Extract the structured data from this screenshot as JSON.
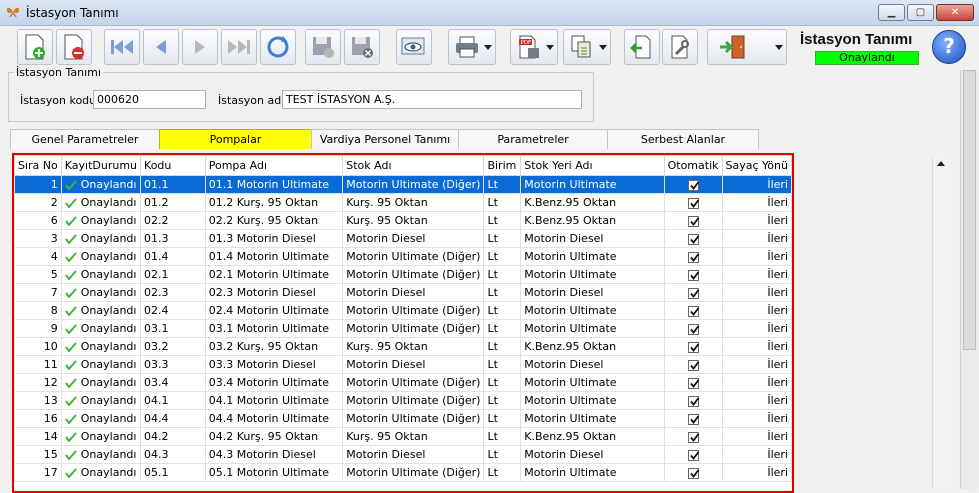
{
  "window": {
    "title": "İstasyon Tanımı"
  },
  "header": {
    "title": "İstasyon Tanımı",
    "status": "Onaylandı"
  },
  "group": {
    "legend": "İstasyon Tanımı",
    "code_label": "İstasyon kodu",
    "code_value": "000620",
    "name_label": "İstasyon adı",
    "name_value": "TEST İSTASYON A.Ş."
  },
  "tabs": [
    {
      "label": "Genel Parametreler"
    },
    {
      "label": "Pompalar",
      "active": true
    },
    {
      "label": "Vardiya Personel Tanımı"
    },
    {
      "label": "Parametreler"
    },
    {
      "label": "Serbest Alanlar"
    }
  ],
  "toolbar": {
    "icons": [
      "new-icon",
      "delete-icon",
      "first-icon",
      "previous-icon",
      "next-icon",
      "last-icon",
      "refresh-icon",
      "save-icon",
      "cancel-icon",
      "preview-icon",
      "print-icon",
      "pdf-export-icon",
      "copy-icon",
      "import-icon",
      "tools-icon",
      "exit-icon",
      "help-icon"
    ],
    "pdf_label": "PDF",
    "help_label": "?"
  },
  "grid": {
    "columns": [
      "Sıra No",
      "KayıtDurumu",
      "Kodu",
      "Pompa Adı",
      "Stok Adı",
      "Birim",
      "Stok Yeri Adı",
      "Otomatik",
      "Sayaç Yönü"
    ],
    "rows": [
      {
        "sira": "1",
        "durum": "Onaylandı",
        "kodu": "01.1",
        "pompa": "01.1 Motorin Ultimate",
        "stok": "Motorin Ultimate (Diğer)",
        "birim": "Lt",
        "yer": "Motorin Ultimate",
        "yon": "İleri"
      },
      {
        "sira": "2",
        "durum": "Onaylandı",
        "kodu": "01.2",
        "pompa": "01.2 Kurş. 95 Oktan",
        "stok": "Kurş. 95 Oktan",
        "birim": "Lt",
        "yer": "K.Benz.95 Oktan",
        "yon": "İleri"
      },
      {
        "sira": "6",
        "durum": "Onaylandı",
        "kodu": "02.2",
        "pompa": "02.2 Kurş. 95 Oktan",
        "stok": "Kurş. 95 Oktan",
        "birim": "Lt",
        "yer": "K.Benz.95 Oktan",
        "yon": "İleri"
      },
      {
        "sira": "3",
        "durum": "Onaylandı",
        "kodu": "01.3",
        "pompa": "01.3 Motorin Diesel",
        "stok": "Motorin Diesel",
        "birim": "Lt",
        "yer": "Motorin Diesel",
        "yon": "İleri"
      },
      {
        "sira": "4",
        "durum": "Onaylandı",
        "kodu": "01.4",
        "pompa": "01.4 Motorin Ultimate",
        "stok": "Motorin Ultimate (Diğer)",
        "birim": "Lt",
        "yer": "Motorin Ultimate",
        "yon": "İleri"
      },
      {
        "sira": "5",
        "durum": "Onaylandı",
        "kodu": "02.1",
        "pompa": "02.1 Motorin Ultimate",
        "stok": "Motorin Ultimate (Diğer)",
        "birim": "Lt",
        "yer": "Motorin Ultimate",
        "yon": "İleri"
      },
      {
        "sira": "7",
        "durum": "Onaylandı",
        "kodu": "02.3",
        "pompa": "02.3 Motorin Diesel",
        "stok": "Motorin Diesel",
        "birim": "Lt",
        "yer": "Motorin Diesel",
        "yon": "İleri"
      },
      {
        "sira": "8",
        "durum": "Onaylandı",
        "kodu": "02.4",
        "pompa": "02.4 Motorin Ultimate",
        "stok": "Motorin Ultimate (Diğer)",
        "birim": "Lt",
        "yer": "Motorin Ultimate",
        "yon": "İleri"
      },
      {
        "sira": "9",
        "durum": "Onaylandı",
        "kodu": "03.1",
        "pompa": "03.1 Motorin Ultimate",
        "stok": "Motorin Ultimate (Diğer)",
        "birim": "Lt",
        "yer": "Motorin Ultimate",
        "yon": "İleri"
      },
      {
        "sira": "10",
        "durum": "Onaylandı",
        "kodu": "03.2",
        "pompa": "03.2 Kurş. 95 Oktan",
        "stok": "Kurş. 95 Oktan",
        "birim": "Lt",
        "yer": "K.Benz.95 Oktan",
        "yon": "İleri"
      },
      {
        "sira": "11",
        "durum": "Onaylandı",
        "kodu": "03.3",
        "pompa": "03.3 Motorin Diesel",
        "stok": "Motorin Diesel",
        "birim": "Lt",
        "yer": "Motorin Diesel",
        "yon": "İleri"
      },
      {
        "sira": "12",
        "durum": "Onaylandı",
        "kodu": "03.4",
        "pompa": "03.4 Motorin Ultimate",
        "stok": "Motorin Ultimate (Diğer)",
        "birim": "Lt",
        "yer": "Motorin Ultimate",
        "yon": "İleri"
      },
      {
        "sira": "13",
        "durum": "Onaylandı",
        "kodu": "04.1",
        "pompa": "04.1 Motorin Ultimate",
        "stok": "Motorin Ultimate (Diğer)",
        "birim": "Lt",
        "yer": "Motorin Ultimate",
        "yon": "İleri"
      },
      {
        "sira": "16",
        "durum": "Onaylandı",
        "kodu": "04.4",
        "pompa": "04.4 Motorin Ultimate",
        "stok": "Motorin Ultimate (Diğer)",
        "birim": "Lt",
        "yer": "Motorin Ultimate",
        "yon": "İleri"
      },
      {
        "sira": "14",
        "durum": "Onaylandı",
        "kodu": "04.2",
        "pompa": "04.2 Kurş. 95 Oktan",
        "stok": "Kurş. 95 Oktan",
        "birim": "Lt",
        "yer": "K.Benz.95 Oktan",
        "yon": "İleri"
      },
      {
        "sira": "15",
        "durum": "Onaylandı",
        "kodu": "04.3",
        "pompa": "04.3 Motorin Diesel",
        "stok": "Motorin Diesel",
        "birim": "Lt",
        "yer": "Motorin Diesel",
        "yon": "İleri"
      },
      {
        "sira": "17",
        "durum": "Onaylandı",
        "kodu": "05.1",
        "pompa": "05.1 Motorin Ultimate",
        "stok": "Motorin Ultimate (Diğer)",
        "birim": "Lt",
        "yer": "Motorin Ultimate",
        "yon": "İleri"
      }
    ]
  },
  "colors": {
    "accent_selection": "#0a6ad6",
    "active_tab": "#ffff00",
    "status_green": "#00ff00",
    "grid_border": "#e00000"
  }
}
